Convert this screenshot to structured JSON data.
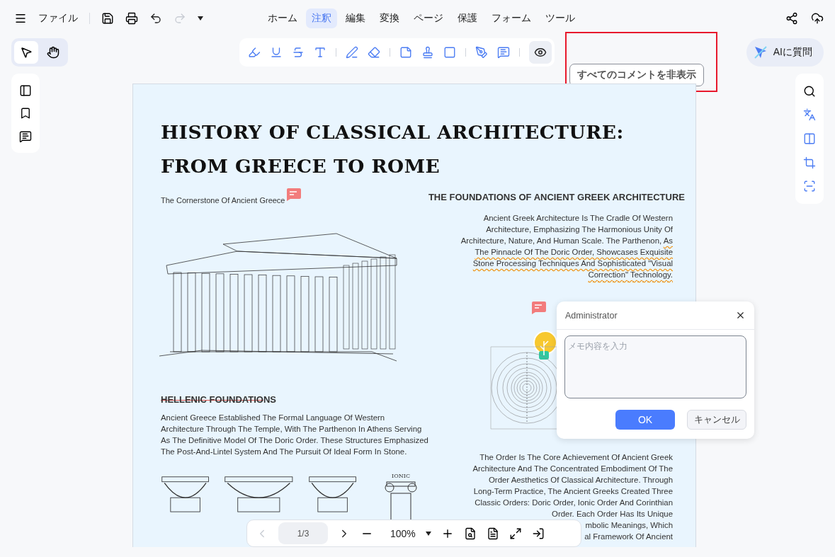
{
  "menu_bar": {
    "file_label": "ファイル",
    "undo_disabled": false,
    "redo_disabled": true
  },
  "tabs": [
    {
      "label": "ホーム",
      "selected": false
    },
    {
      "label": "注釈",
      "selected": true
    },
    {
      "label": "編集",
      "selected": false
    },
    {
      "label": "変換",
      "selected": false
    },
    {
      "label": "ページ",
      "selected": false
    },
    {
      "label": "保護",
      "selected": false
    },
    {
      "label": "フォーム",
      "selected": false
    },
    {
      "label": "ツール",
      "selected": false
    }
  ],
  "tools": [
    {
      "kind": "select",
      "selected": true
    },
    {
      "kind": "hand",
      "selected": false
    }
  ],
  "annotation_toolbar": {
    "hide_comments_selected": true,
    "tooltip": "すべてのコメントを非表示"
  },
  "ai_button": {
    "label": "AIに質問"
  },
  "document": {
    "title_lines": [
      "HISTORY OF CLASSICAL ARCHITECTURE:",
      "FROM GREECE TO ROME"
    ],
    "subtitle": "The Cornerstone Of Ancient Greece",
    "left_heading": {
      "struck_part": "HELLENIC FOUNDATIO",
      "plain_part": "NS"
    },
    "left_paragraph": "Ancient Greece Established The Formal Language Of Western Architecture Through The Temple, With The Parthenon In Athens Serving As The Definitive Model Of The Doric Order. These Structures Emphasized The Post-And-Lintel System And The Pursuit Of Ideal Form In Stone.",
    "column_label": "IONIC",
    "right_heading": "THE FOUNDATIONS OF ANCIENT GREEK ARCHITECTURE",
    "right_paragraph": {
      "plain_part": "Ancient Greek Architecture Is The Cradle Of Western Architecture, Emphasizing The Harmonious Unity Of Architecture, Nature, And Human Scale. The Parthenon,",
      "squiggled_part": "As The Pinnacle Of The Doric Order, Showcases Exquisite Stone Processing Techniques And Sophisticated \"Visual Correction\" Technology."
    },
    "bottom_paragraph": "The Order Is The Core Achievement Of Ancient Greek Architecture And The Concentrated Embodiment Of The Order Aesthetics Of Classical Architecture. Through Long-Term Practice, The Ancient Greeks Created Three Classic Orders: Doric Order, Ionic Order And Corinthian Order. Each Order Has Its Unique",
    "bottom_fragments": [
      "mbolic Meanings, Which",
      "al Framework Of Ancient"
    ]
  },
  "comment_popup": {
    "author": "Administrator",
    "placeholder": "メモ内容を入力",
    "ok": "OK",
    "cancel": "キャンセル"
  },
  "page_nav": {
    "prev_disabled": true,
    "page": "1/3",
    "zoom": "100%"
  }
}
